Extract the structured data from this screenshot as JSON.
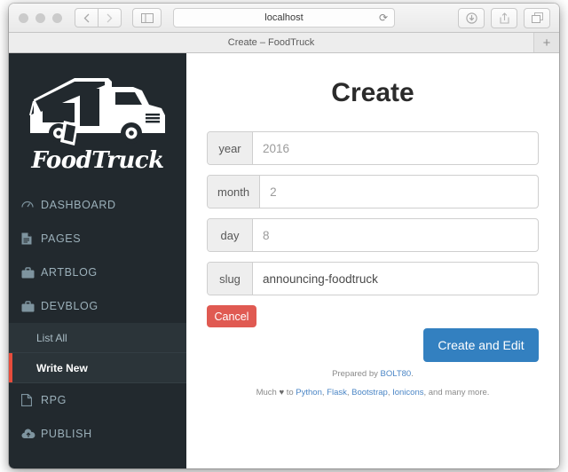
{
  "browser": {
    "address_value": "localhost",
    "reload_icon": "reload-icon",
    "back_icon": "chevron-left-icon",
    "forward_icon": "chevron-right-icon",
    "sidebar_toggle_icon": "sidebar-icon",
    "downloads_icon": "download-icon",
    "share_icon": "share-icon",
    "tabs_icon": "tabs-icon",
    "tab_title": "Create – FoodTruck",
    "new_tab_label": "+"
  },
  "sidebar": {
    "brand": "FoodTruck",
    "logo_icon": "food-truck-logo",
    "items": [
      {
        "label": "DASHBOARD",
        "icon": "speedometer-icon"
      },
      {
        "label": "PAGES",
        "icon": "document-text-icon"
      },
      {
        "label": "ARTBLOG",
        "icon": "briefcase-icon"
      },
      {
        "label": "DEVBLOG",
        "icon": "briefcase-icon"
      }
    ],
    "submenu": [
      {
        "label": "List All",
        "active": false
      },
      {
        "label": "Write New",
        "active": true
      }
    ],
    "items_after": [
      {
        "label": "RPG",
        "icon": "document-outline-icon"
      },
      {
        "label": "PUBLISH",
        "icon": "cloud-upload-icon"
      }
    ],
    "active_accent_color": "#e74c3c",
    "background_color": "#22292e"
  },
  "main": {
    "title": "Create",
    "fields": [
      {
        "label": "year",
        "value": "2016",
        "filled": false
      },
      {
        "label": "month",
        "value": "2",
        "filled": false
      },
      {
        "label": "day",
        "value": "8",
        "filled": false
      },
      {
        "label": "slug",
        "value": "announcing-foodtruck",
        "filled": true
      }
    ],
    "cancel_label": "Cancel",
    "submit_label": "Create and Edit",
    "cancel_color": "#e05a52",
    "submit_color": "#3380c0"
  },
  "footer": {
    "line1_prefix": "Prepared by ",
    "line1_link": "BOLT80",
    "line1_suffix": ".",
    "line2_prefix": "Much ",
    "heart": "♥",
    "line2_to": " to ",
    "links": [
      "Python",
      "Flask",
      "Bootstrap",
      "Ionicons"
    ],
    "line2_suffix": ", and many more.",
    "separator": ", ",
    "link_color": "#4b86c6"
  }
}
